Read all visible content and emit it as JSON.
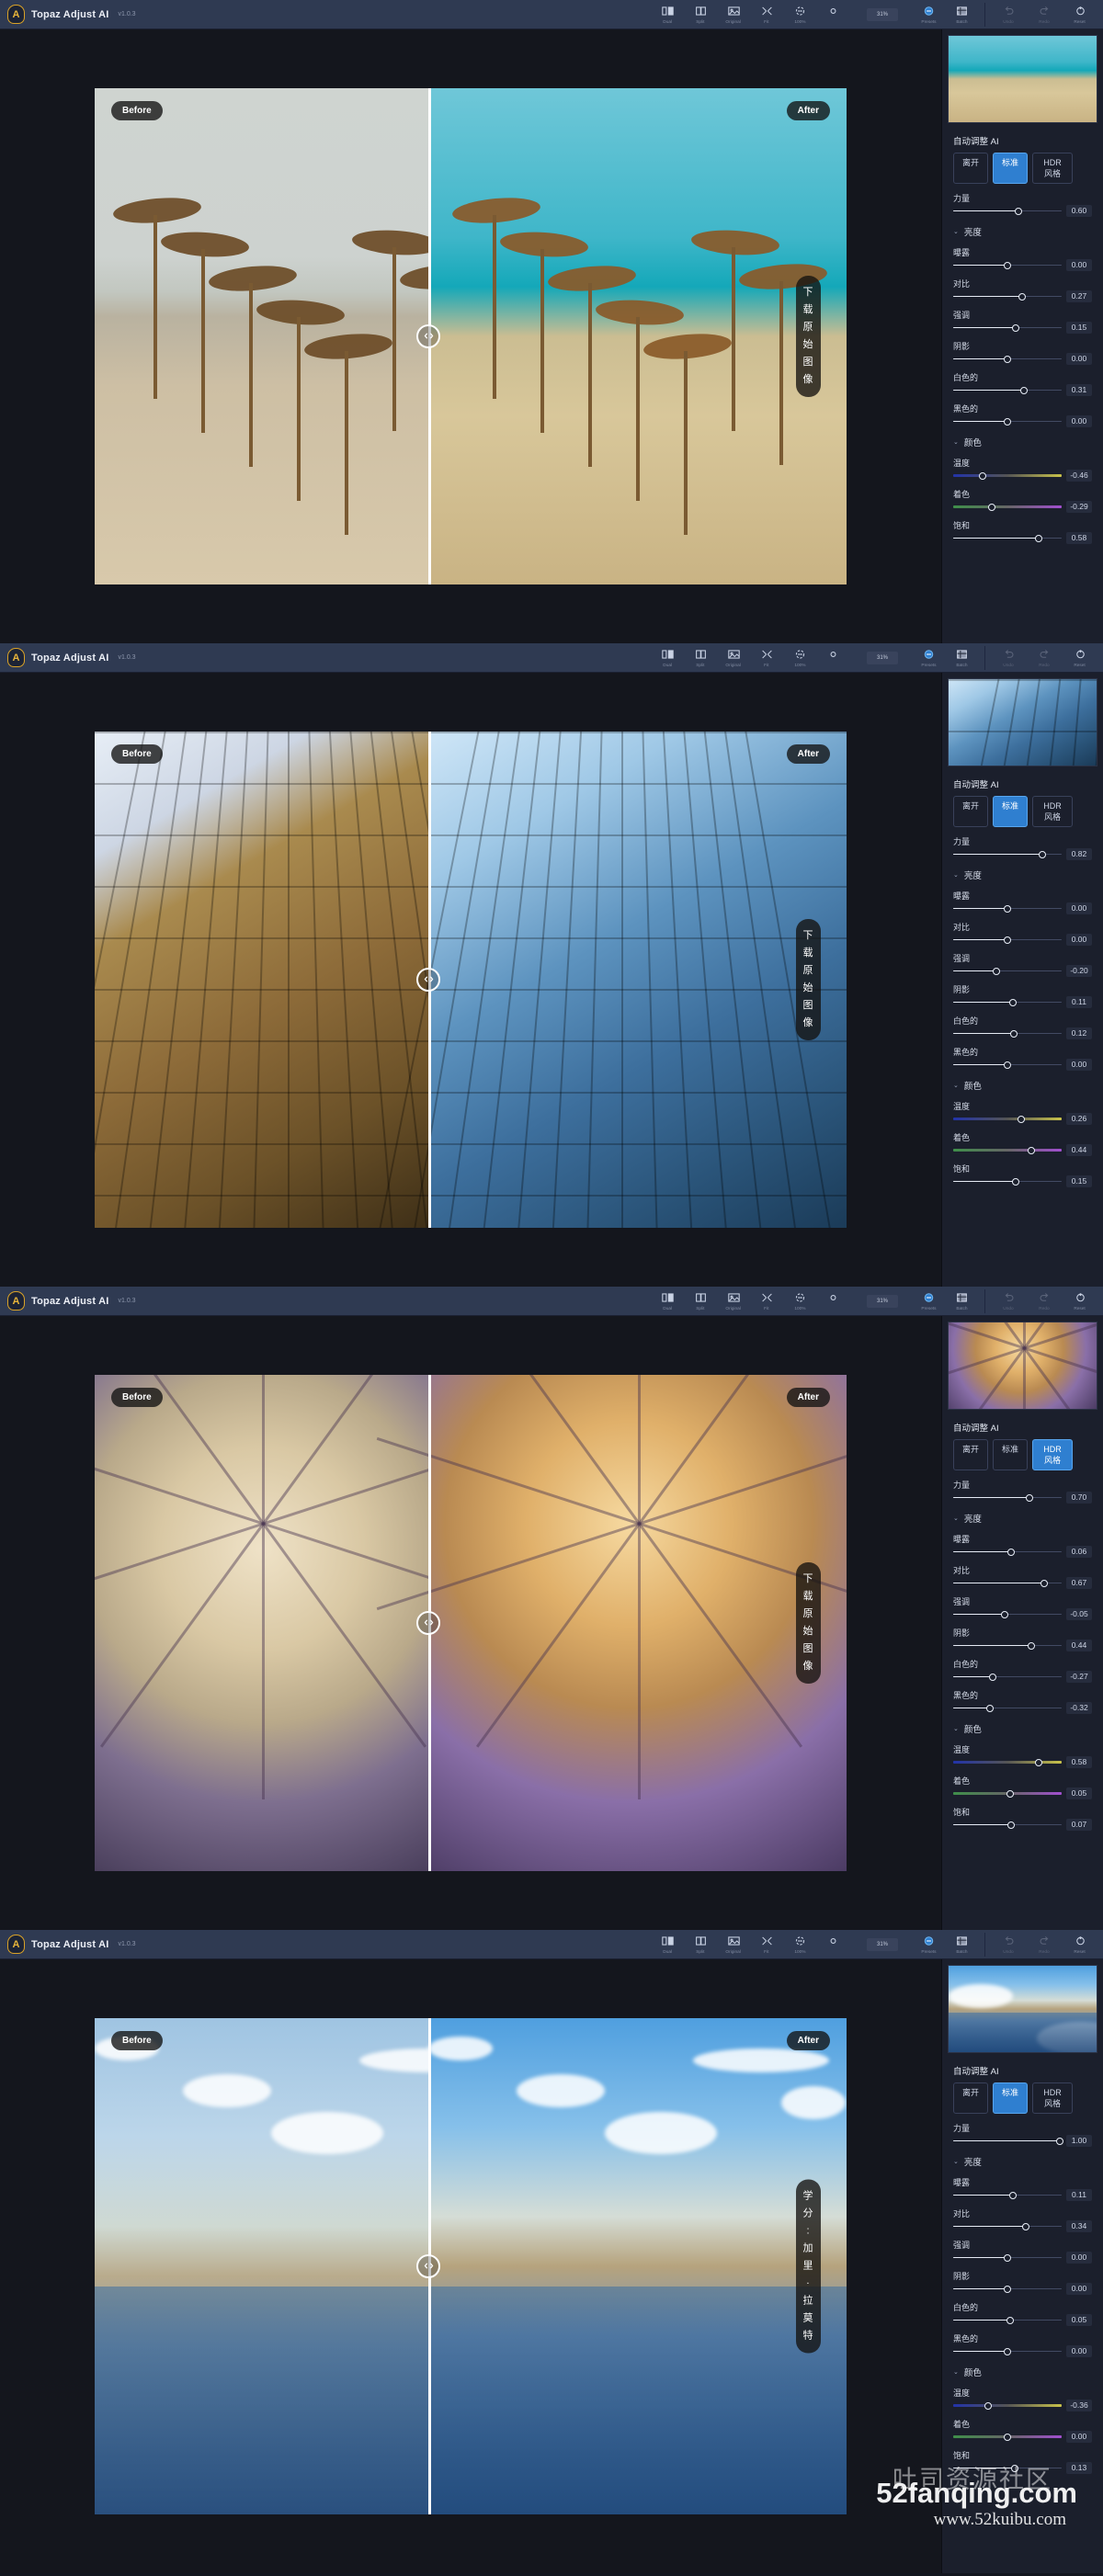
{
  "app": {
    "title": "Topaz Adjust AI",
    "version": "v1.0.3",
    "logo_letter": "A"
  },
  "toolbar": {
    "view_tools": [
      {
        "name": "dual-view",
        "label": "Dual",
        "icon": "dual-pane-icon"
      },
      {
        "name": "split-view",
        "label": "Split",
        "icon": "split-pane-icon"
      },
      {
        "name": "original-view",
        "label": "Original",
        "icon": "image-icon"
      },
      {
        "name": "fit-view",
        "label": "Fit",
        "icon": "fit-screen-icon"
      },
      {
        "name": "hundred-view",
        "label": "100%",
        "icon": "one-to-one-icon"
      },
      {
        "name": "navigator",
        "label": "",
        "icon": "circle-icon"
      }
    ],
    "zoom_level": "31%",
    "right_tools": [
      {
        "name": "presets",
        "label": "Presets",
        "icon": "presets-icon"
      },
      {
        "name": "batch",
        "label": "Batch",
        "icon": "batch-icon"
      }
    ],
    "history_tools": [
      {
        "name": "undo",
        "label": "Undo",
        "icon": "undo-arrow-icon"
      },
      {
        "name": "redo",
        "label": "Redo",
        "icon": "redo-arrow-icon"
      },
      {
        "name": "reset",
        "label": "Reset",
        "icon": "reset-circle-icon"
      }
    ]
  },
  "viewer": {
    "before_label": "Before",
    "after_label": "After",
    "handle_icon": "split-handle-icon"
  },
  "rail_labels": {
    "auto_adjust": "自动调整 AI",
    "mode_off": "离开",
    "mode_standard": "标准",
    "mode_hdr": "HDR 风格",
    "strength": "力量",
    "group_brightness": "亮度",
    "exposure": "曝露",
    "contrast": "对比",
    "highlights": "强调",
    "shadows": "阴影",
    "whites": "白色的",
    "blacks": "黑色的",
    "group_color": "颜色",
    "temperature": "温度",
    "tint": "着色",
    "saturation": "饱和",
    "chevron": "⌄"
  },
  "panels": [
    {
      "id": "panel-beach",
      "subject": "beach umbrellas",
      "overlay_text": "下载原始图像",
      "selected_mode": "标准",
      "values": {
        "strength": "0.60",
        "exposure": "0.00",
        "contrast": "0.27",
        "highlights": "0.15",
        "shadows": "0.00",
        "whites": "0.31",
        "blacks": "0.00",
        "temperature": "-0.46",
        "tint": "-0.29",
        "saturation": "0.58"
      }
    },
    {
      "id": "panel-louvre",
      "subject": "glass pyramid",
      "overlay_text": "下载原始图像",
      "selected_mode": "标准",
      "values": {
        "strength": "0.82",
        "exposure": "0.00",
        "contrast": "0.00",
        "highlights": "-0.20",
        "shadows": "0.11",
        "whites": "0.12",
        "blacks": "0.00",
        "temperature": "0.26",
        "tint": "0.44",
        "saturation": "0.15"
      }
    },
    {
      "id": "panel-dome",
      "subject": "cathedral dome",
      "overlay_text": "下载原始图像",
      "selected_mode": "HDR 风格",
      "values": {
        "strength": "0.70",
        "exposure": "0.06",
        "contrast": "0.67",
        "highlights": "-0.05",
        "shadows": "0.44",
        "whites": "-0.27",
        "blacks": "-0.32",
        "temperature": "0.58",
        "tint": "0.05",
        "saturation": "0.07"
      }
    },
    {
      "id": "panel-lake",
      "subject": "lake reflection",
      "overlay_text": "学分: 加里·拉莫特",
      "selected_mode": "标准",
      "values": {
        "strength": "1.00",
        "exposure": "0.11",
        "contrast": "0.34",
        "highlights": "0.00",
        "shadows": "0.00",
        "whites": "0.05",
        "blacks": "0.00",
        "temperature": "-0.36",
        "tint": "0.00",
        "saturation": "0.13"
      }
    }
  ],
  "watermarks": {
    "primary": "52fanqing.com",
    "secondary": "www.52kuibu.com",
    "tertiary": "吐司资源社区"
  }
}
